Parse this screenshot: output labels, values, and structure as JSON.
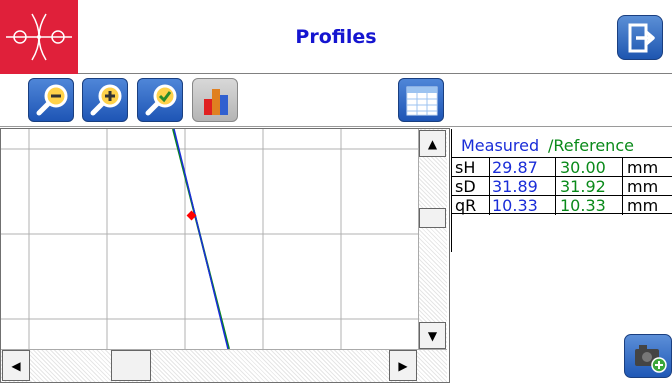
{
  "header": {
    "title": "Profiles"
  },
  "icons": {
    "logo": "profile-logo-icon",
    "exit": "exit-icon",
    "zoom_out": "zoom-out-icon",
    "zoom_in": "zoom-in-icon",
    "zoom_fit": "zoom-fit-icon",
    "chart": "bar-chart-icon",
    "table": "table-icon",
    "camera": "camera-add-icon"
  },
  "measurements": {
    "headers": {
      "measured": "Measured",
      "reference": "/Reference"
    },
    "rows": [
      {
        "label": "sH",
        "measured": "29.87",
        "reference": "30.00",
        "unit": "mm"
      },
      {
        "label": "sD",
        "measured": "31.89",
        "reference": "31.92",
        "unit": "mm"
      },
      {
        "label": "qR",
        "measured": "10.33",
        "reference": "10.33",
        "unit": "mm"
      }
    ]
  },
  "colors": {
    "accent": "#1515d0",
    "measured": "#1a2dd8",
    "reference": "#0a8a1a",
    "logo_bg": "#e0203a",
    "marker": "#ff0000"
  }
}
